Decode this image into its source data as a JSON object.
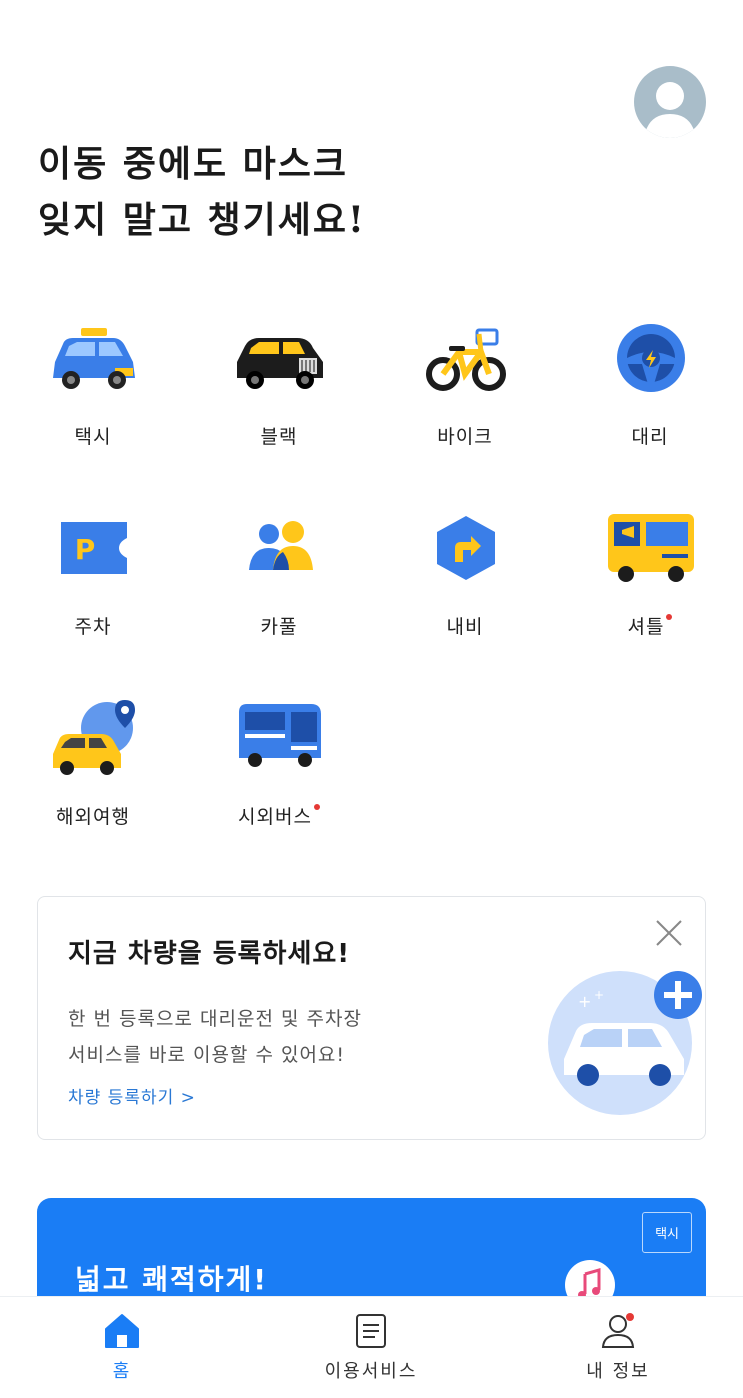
{
  "header": {
    "headline_line1": "이동 중에도 마스크",
    "headline_line2": "잊지 말고 챙기세요!"
  },
  "services": [
    {
      "label": "택시",
      "icon": "taxi-icon",
      "new": false
    },
    {
      "label": "블랙",
      "icon": "black-car-icon",
      "new": false
    },
    {
      "label": "바이크",
      "icon": "bike-icon",
      "new": false
    },
    {
      "label": "대리",
      "icon": "steering-wheel-icon",
      "new": false
    },
    {
      "label": "주차",
      "icon": "parking-ticket-icon",
      "new": false
    },
    {
      "label": "카풀",
      "icon": "carpool-people-icon",
      "new": false
    },
    {
      "label": "내비",
      "icon": "navigation-icon",
      "new": false
    },
    {
      "label": "셔틀",
      "icon": "shuttle-bus-icon",
      "new": true
    },
    {
      "label": "해외여행",
      "icon": "overseas-taxi-icon",
      "new": false
    },
    {
      "label": "시외버스",
      "icon": "intercity-bus-icon",
      "new": true
    }
  ],
  "register_card": {
    "title": "지금 차량을 등록하세요!",
    "desc_line1": "한 번 등록으로 대리운전 및 주차장",
    "desc_line2": "서비스를 바로 이용할 수 있어요!",
    "link": "차량 등록하기 >"
  },
  "promo": {
    "tag": "택시",
    "title": "넓고 쾌적하게!"
  },
  "tabbar": {
    "home": "홈",
    "services": "이용서비스",
    "my_info": "내 정보"
  },
  "colors": {
    "accent": "#1a7df5",
    "yellow": "#ffc61a",
    "badge": "#e53935"
  }
}
